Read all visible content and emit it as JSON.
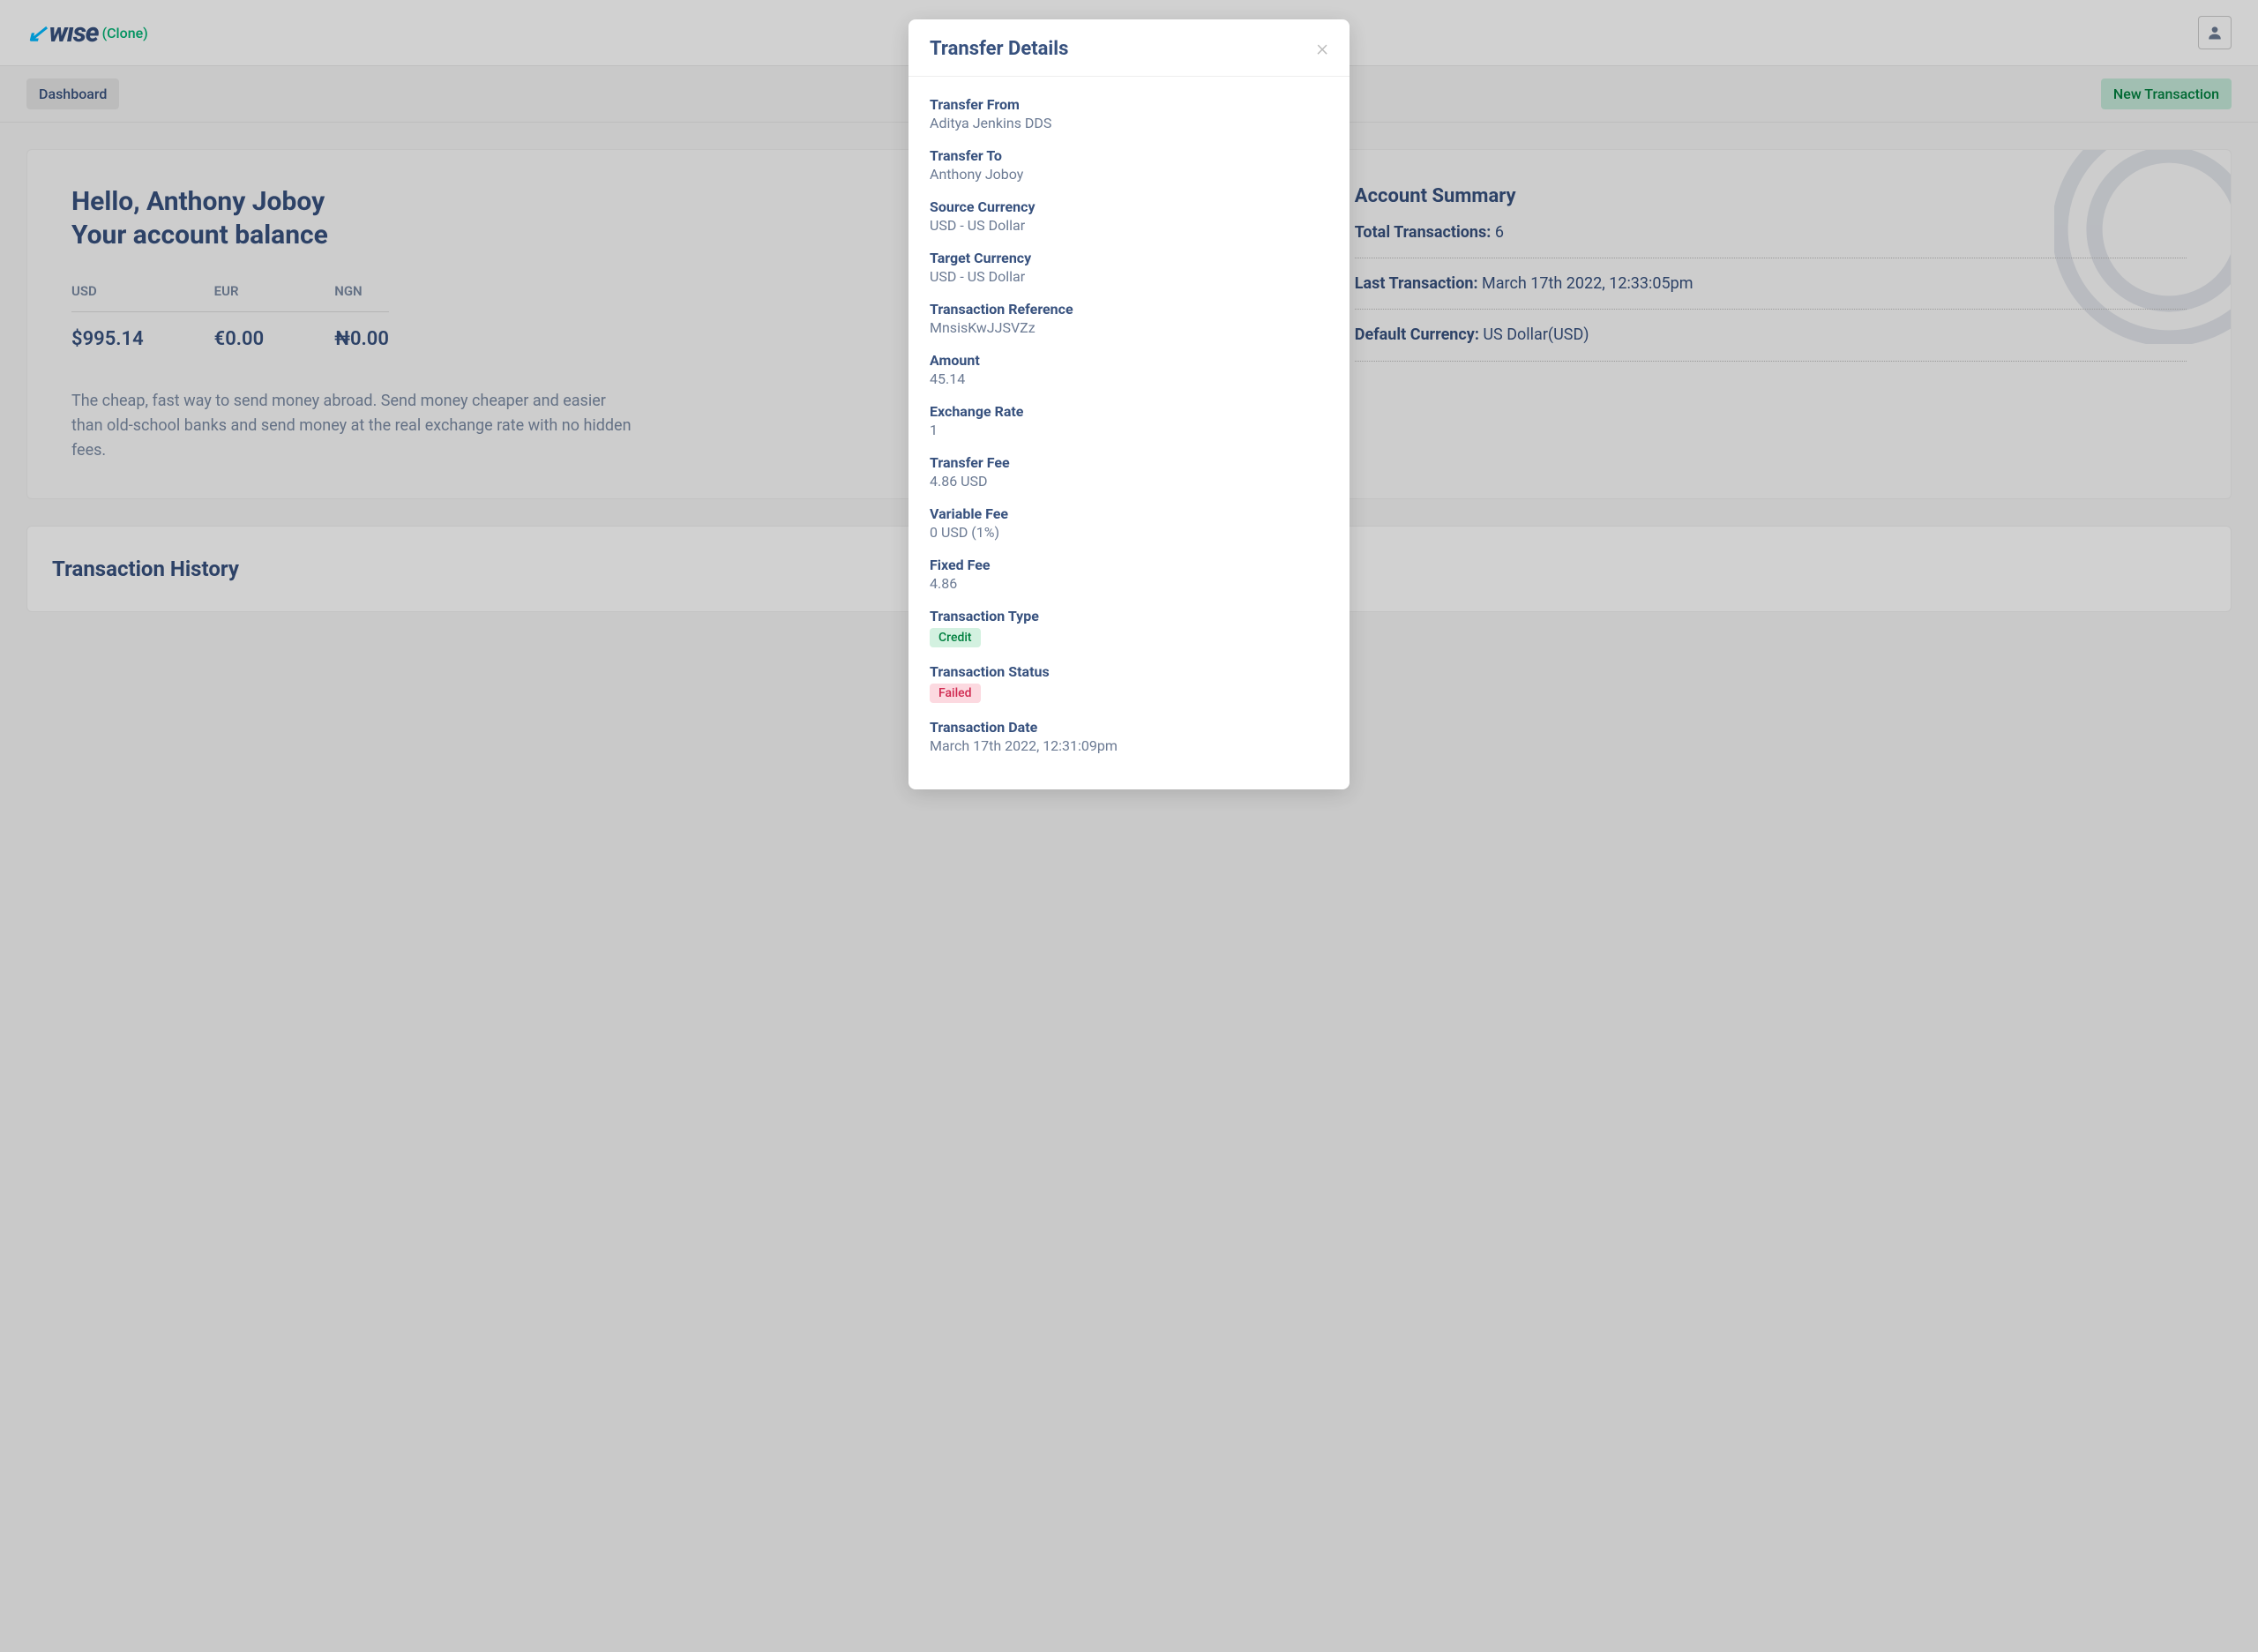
{
  "brand": {
    "name": "wıse",
    "tag": "(Clone)"
  },
  "nav": {
    "dashboard": "Dashboard",
    "new_tx": "New Transaction"
  },
  "greeting_line1": "Hello, Anthony Joboy",
  "greeting_line2": "Your account balance",
  "balances": {
    "usd_label": "USD",
    "usd_value": "$995.14",
    "eur_label": "EUR",
    "eur_value": "€0.00",
    "ngn_label": "NGN",
    "ngn_value": "₦0.00"
  },
  "description": "The cheap, fast way to send money abroad. Send money cheaper and easier than old-school banks and send money at the real exchange rate with no hidden fees.",
  "summary": {
    "title": "Account Summary",
    "total_label": "Total Transactions:",
    "total_value": "6",
    "last_label": "Last Transaction:",
    "last_value": "March 17th 2022, 12:33:05pm",
    "default_label": "Default Currency:",
    "default_value": "US Dollar(USD)"
  },
  "history_title": "Transaction History",
  "modal": {
    "title": "Transfer Details",
    "from_k": "Transfer From",
    "from_v": "Aditya Jenkins DDS",
    "to_k": "Transfer To",
    "to_v": "Anthony Joboy",
    "src_k": "Source Currency",
    "src_v": "USD - US Dollar",
    "tgt_k": "Target Currency",
    "tgt_v": "USD - US Dollar",
    "ref_k": "Transaction Reference",
    "ref_v": "MnsisKwJJSVZz",
    "amt_k": "Amount",
    "amt_v": "45.14",
    "rate_k": "Exchange Rate",
    "rate_v": "1",
    "fee_k": "Transfer Fee",
    "fee_v": "4.86 USD",
    "varfee_k": "Variable Fee",
    "varfee_v": "0 USD (1%)",
    "fixfee_k": "Fixed Fee",
    "fixfee_v": "4.86",
    "type_k": "Transaction Type",
    "type_v": "Credit",
    "status_k": "Transaction Status",
    "status_v": "Failed",
    "date_k": "Transaction Date",
    "date_v": "March 17th 2022, 12:31:09pm"
  }
}
